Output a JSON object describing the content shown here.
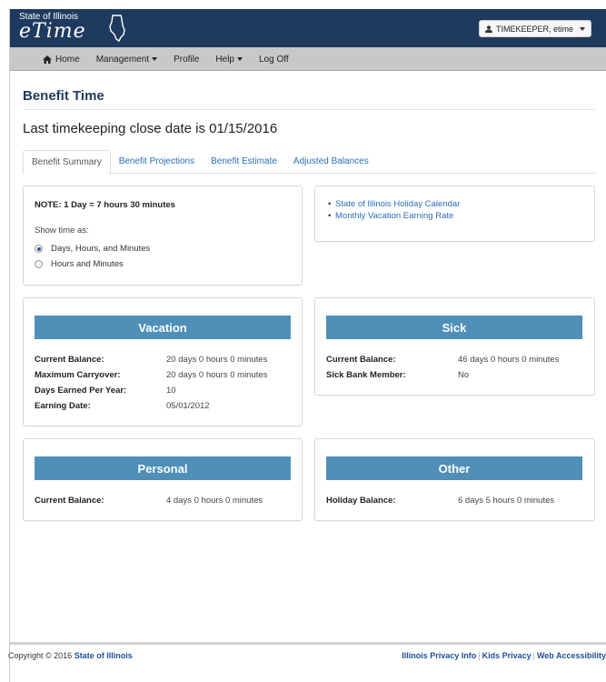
{
  "header": {
    "logo_top": "State of Illinois",
    "logo_main": "eTime",
    "user_label": "TIMEKEEPER, etime"
  },
  "nav": {
    "home": "Home",
    "management": "Management",
    "profile": "Profile",
    "help": "Help",
    "logoff": "Log Off"
  },
  "page": {
    "title": "Benefit Time",
    "close_date": "Last timekeeping close date is 01/15/2016"
  },
  "tabs": [
    "Benefit Summary",
    "Benefit Projections",
    "Benefit Estimate",
    "Adjusted Balances"
  ],
  "settings": {
    "note": "NOTE: 1 Day = 7 hours 30 minutes",
    "show_label": "Show time as:",
    "option1": "Days, Hours, and Minutes",
    "option2": "Hours and Minutes"
  },
  "links": [
    "State of Illinois Holiday Calendar",
    "Monthly Vacation Earning Rate"
  ],
  "vacation": {
    "title": "Vacation",
    "rows": [
      {
        "label": "Current Balance:",
        "value": "20 days 0 hours 0 minutes"
      },
      {
        "label": "Maximum Carryover:",
        "value": "20 days 0 hours 0 minutes"
      },
      {
        "label": "Days Earned Per Year:",
        "value": "10"
      },
      {
        "label": "Earning Date:",
        "value": "05/01/2012"
      }
    ]
  },
  "sick": {
    "title": "Sick",
    "rows": [
      {
        "label": "Current Balance:",
        "value": "46 days 0 hours 0 minutes"
      },
      {
        "label": "Sick Bank Member:",
        "value": "No"
      }
    ]
  },
  "personal": {
    "title": "Personal",
    "rows": [
      {
        "label": "Current Balance:",
        "value": "4 days 0 hours 0 minutes"
      }
    ]
  },
  "other": {
    "title": "Other",
    "rows": [
      {
        "label": "Holiday Balance:",
        "value": "6 days 5 hours 0 minutes"
      }
    ]
  },
  "footer": {
    "copyright": "Copyright © 2016",
    "org": "State of Illinois",
    "privacy": "Illinois Privacy Info",
    "kids": "Kids Privacy",
    "access": "Web Accessibility",
    "separator": "|"
  }
}
